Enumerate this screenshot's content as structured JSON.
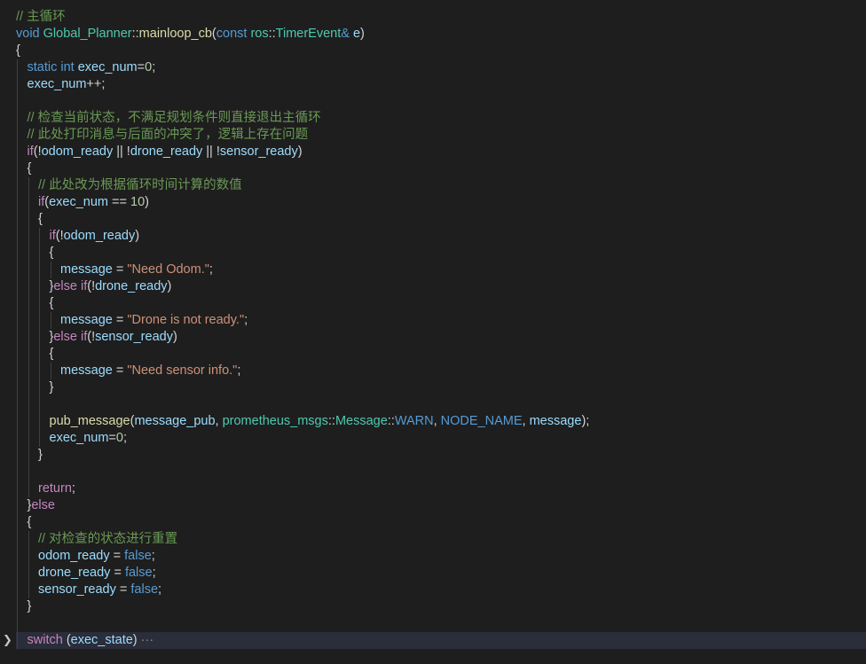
{
  "editor": {
    "language": "cpp",
    "folded_line_index": 37,
    "lines": [
      {
        "indent": 0,
        "tokens": [
          [
            "// 主循环",
            "comment"
          ]
        ]
      },
      {
        "indent": 0,
        "tokens": [
          [
            "void",
            "keyword"
          ],
          [
            " ",
            "punc"
          ],
          [
            "Global_Planner",
            "type"
          ],
          [
            "::",
            "punc"
          ],
          [
            "mainloop_cb",
            "func"
          ],
          [
            "(",
            "punc"
          ],
          [
            "const",
            "keyword"
          ],
          [
            " ",
            "punc"
          ],
          [
            "ros",
            "type"
          ],
          [
            "::",
            "punc"
          ],
          [
            "TimerEvent",
            "type"
          ],
          [
            "&",
            "keyword"
          ],
          [
            " ",
            "punc"
          ],
          [
            "e",
            "var"
          ],
          [
            ")",
            "punc"
          ]
        ]
      },
      {
        "indent": 0,
        "tokens": [
          [
            "{",
            "punc"
          ]
        ]
      },
      {
        "indent": 1,
        "tokens": [
          [
            "static",
            "keyword"
          ],
          [
            " ",
            "punc"
          ],
          [
            "int",
            "keyword"
          ],
          [
            " ",
            "punc"
          ],
          [
            "exec_num",
            "var"
          ],
          [
            "=",
            "op"
          ],
          [
            "0",
            "num"
          ],
          [
            ";",
            "punc"
          ]
        ]
      },
      {
        "indent": 1,
        "tokens": [
          [
            "exec_num",
            "var"
          ],
          [
            "++;",
            "op"
          ]
        ]
      },
      {
        "indent": 1,
        "tokens": []
      },
      {
        "indent": 1,
        "tokens": [
          [
            "// 检查当前状态，不满足规划条件则直接退出主循环",
            "comment"
          ]
        ]
      },
      {
        "indent": 1,
        "tokens": [
          [
            "// 此处打印消息与后面的冲突了，逻辑上存在问题",
            "comment"
          ]
        ]
      },
      {
        "indent": 1,
        "tokens": [
          [
            "if",
            "control"
          ],
          [
            "(!",
            "punc"
          ],
          [
            "odom_ready",
            "var"
          ],
          [
            " || !",
            "op"
          ],
          [
            "drone_ready",
            "var"
          ],
          [
            " || !",
            "op"
          ],
          [
            "sensor_ready",
            "var"
          ],
          [
            ")",
            "punc"
          ]
        ]
      },
      {
        "indent": 1,
        "tokens": [
          [
            "{",
            "punc"
          ]
        ]
      },
      {
        "indent": 2,
        "tokens": [
          [
            "// 此处改为根据循环时间计算的数值",
            "comment"
          ]
        ]
      },
      {
        "indent": 2,
        "tokens": [
          [
            "if",
            "control"
          ],
          [
            "(",
            "punc"
          ],
          [
            "exec_num",
            "var"
          ],
          [
            " == ",
            "op"
          ],
          [
            "10",
            "num"
          ],
          [
            ")",
            "punc"
          ]
        ]
      },
      {
        "indent": 2,
        "tokens": [
          [
            "{",
            "punc"
          ]
        ]
      },
      {
        "indent": 3,
        "tokens": [
          [
            "if",
            "control"
          ],
          [
            "(!",
            "punc"
          ],
          [
            "odom_ready",
            "var"
          ],
          [
            ")",
            "punc"
          ]
        ]
      },
      {
        "indent": 3,
        "tokens": [
          [
            "{",
            "punc"
          ]
        ]
      },
      {
        "indent": 4,
        "tokens": [
          [
            "message",
            "var"
          ],
          [
            " = ",
            "op"
          ],
          [
            "\"Need Odom.\"",
            "str"
          ],
          [
            ";",
            "punc"
          ]
        ]
      },
      {
        "indent": 3,
        "tokens": [
          [
            "}",
            "punc"
          ],
          [
            "else",
            "control"
          ],
          [
            " ",
            "punc"
          ],
          [
            "if",
            "control"
          ],
          [
            "(!",
            "punc"
          ],
          [
            "drone_ready",
            "var"
          ],
          [
            ")",
            "punc"
          ]
        ]
      },
      {
        "indent": 3,
        "tokens": [
          [
            "{",
            "punc"
          ]
        ]
      },
      {
        "indent": 4,
        "tokens": [
          [
            "message",
            "var"
          ],
          [
            " = ",
            "op"
          ],
          [
            "\"Drone is not ready.\"",
            "str"
          ],
          [
            ";",
            "punc"
          ]
        ]
      },
      {
        "indent": 3,
        "tokens": [
          [
            "}",
            "punc"
          ],
          [
            "else",
            "control"
          ],
          [
            " ",
            "punc"
          ],
          [
            "if",
            "control"
          ],
          [
            "(!",
            "punc"
          ],
          [
            "sensor_ready",
            "var"
          ],
          [
            ")",
            "punc"
          ]
        ]
      },
      {
        "indent": 3,
        "tokens": [
          [
            "{",
            "punc"
          ]
        ]
      },
      {
        "indent": 4,
        "tokens": [
          [
            "message",
            "var"
          ],
          [
            " = ",
            "op"
          ],
          [
            "\"Need sensor info.\"",
            "str"
          ],
          [
            ";",
            "punc"
          ]
        ]
      },
      {
        "indent": 3,
        "tokens": [
          [
            "}",
            "punc"
          ]
        ]
      },
      {
        "indent": 3,
        "tokens": []
      },
      {
        "indent": 3,
        "tokens": [
          [
            "pub_message",
            "func"
          ],
          [
            "(",
            "punc"
          ],
          [
            "message_pub",
            "var"
          ],
          [
            ", ",
            "punc"
          ],
          [
            "prometheus_msgs",
            "type"
          ],
          [
            "::",
            "punc"
          ],
          [
            "Message",
            "type"
          ],
          [
            "::",
            "punc"
          ],
          [
            "WARN",
            "macro"
          ],
          [
            ", ",
            "punc"
          ],
          [
            "NODE_NAME",
            "macro"
          ],
          [
            ", ",
            "punc"
          ],
          [
            "message",
            "var"
          ],
          [
            ");",
            "punc"
          ]
        ]
      },
      {
        "indent": 3,
        "tokens": [
          [
            "exec_num",
            "var"
          ],
          [
            "=",
            "op"
          ],
          [
            "0",
            "num"
          ],
          [
            ";",
            "punc"
          ]
        ]
      },
      {
        "indent": 2,
        "tokens": [
          [
            "}",
            "punc"
          ]
        ]
      },
      {
        "indent": 2,
        "tokens": []
      },
      {
        "indent": 2,
        "tokens": [
          [
            "return",
            "control"
          ],
          [
            ";",
            "punc"
          ]
        ]
      },
      {
        "indent": 1,
        "tokens": [
          [
            "}",
            "punc"
          ],
          [
            "else",
            "control"
          ]
        ]
      },
      {
        "indent": 1,
        "tokens": [
          [
            "{",
            "punc"
          ]
        ]
      },
      {
        "indent": 2,
        "tokens": [
          [
            "// 对检查的状态进行重置",
            "comment"
          ]
        ]
      },
      {
        "indent": 2,
        "tokens": [
          [
            "odom_ready",
            "var"
          ],
          [
            " = ",
            "op"
          ],
          [
            "false",
            "const"
          ],
          [
            ";",
            "punc"
          ]
        ]
      },
      {
        "indent": 2,
        "tokens": [
          [
            "drone_ready",
            "var"
          ],
          [
            " = ",
            "op"
          ],
          [
            "false",
            "const"
          ],
          [
            ";",
            "punc"
          ]
        ]
      },
      {
        "indent": 2,
        "tokens": [
          [
            "sensor_ready",
            "var"
          ],
          [
            " = ",
            "op"
          ],
          [
            "false",
            "const"
          ],
          [
            ";",
            "punc"
          ]
        ]
      },
      {
        "indent": 1,
        "tokens": [
          [
            "}",
            "punc"
          ]
        ]
      },
      {
        "indent": 1,
        "tokens": []
      },
      {
        "indent": 1,
        "tokens": [
          [
            "switch",
            "control"
          ],
          [
            " (",
            "punc"
          ],
          [
            "exec_state",
            "var"
          ],
          [
            ")",
            "punc"
          ],
          [
            " ···",
            "ellipsis"
          ]
        ]
      }
    ]
  }
}
